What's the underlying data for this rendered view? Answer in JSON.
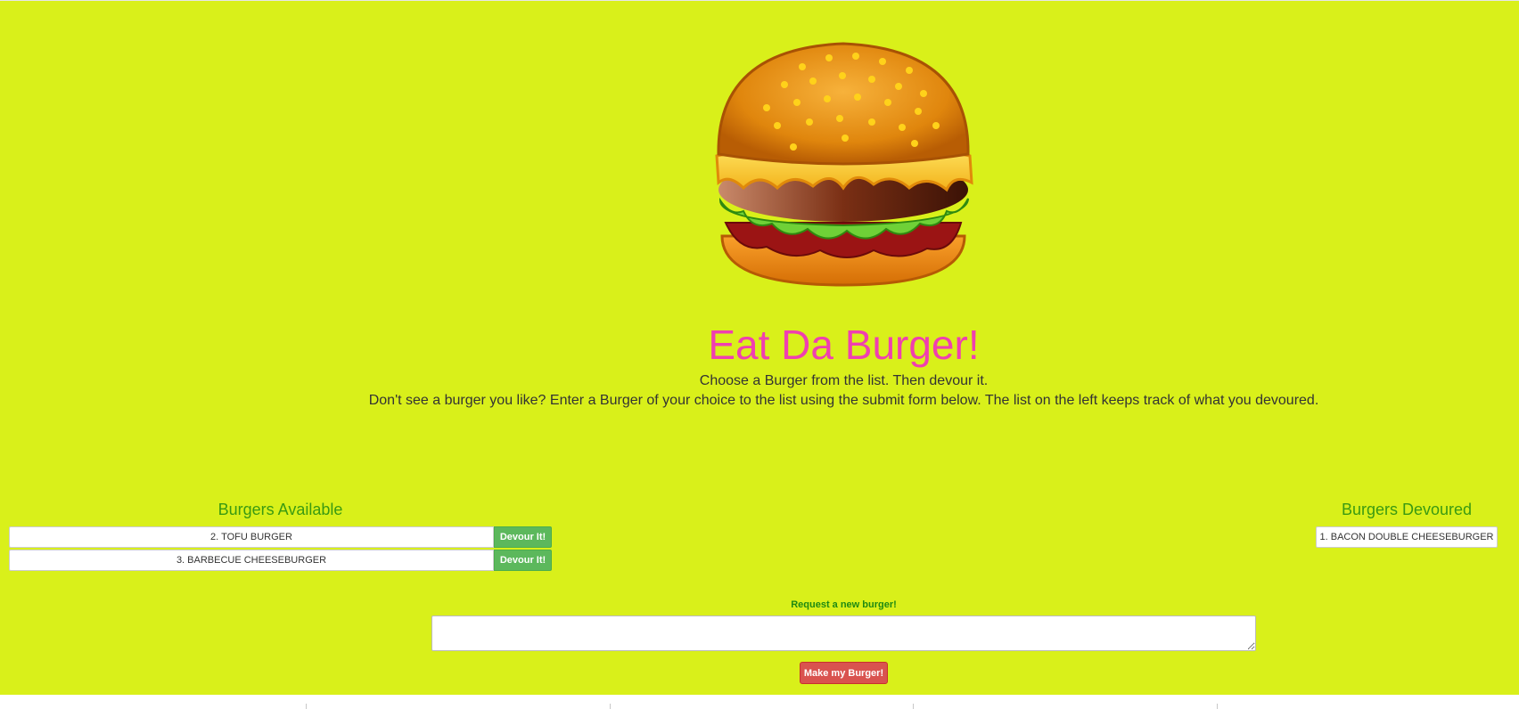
{
  "header": {
    "title": "Eat Da Burger!",
    "subtitle_line1": "Choose a Burger from the list. Then devour it.",
    "subtitle_line2": "Don't see a burger you like? Enter a Burger of your choice to the list using the submit form below. The list on the left keeps track of what you devoured.",
    "logo_icon": "hamburger-icon"
  },
  "available": {
    "heading": "Burgers Available",
    "items": [
      {
        "name": "2. TOFU BURGER",
        "button": "Devour It!"
      },
      {
        "name": "3. BARBECUE CHEESEBURGER",
        "button": "Devour It!"
      }
    ]
  },
  "devoured": {
    "heading": "Burgers Devoured",
    "items": [
      {
        "name": "1. BACON DOUBLE CHEESEBURGER"
      }
    ]
  },
  "form": {
    "label": "Request a new burger!",
    "input_value": "",
    "submit_label": "Make my Burger!"
  },
  "colors": {
    "background": "#d9f01a",
    "title": "#f03fb0",
    "heading": "#3a9a12",
    "devour_button": "#5cb85c",
    "submit_button": "#d9534f"
  }
}
